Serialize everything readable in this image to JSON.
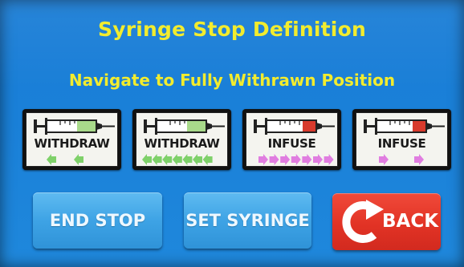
{
  "screen": {
    "title": "Syringe Stop Definition",
    "instruction": "Navigate to Fully Withrawn Position"
  },
  "tiles": [
    {
      "label": "WITHDRAW",
      "direction": "withdraw",
      "speed": "slow",
      "arrow_count": 2,
      "arrow_color": "#7fd16a",
      "plunger_color": "#a8d98a"
    },
    {
      "label": "WITHDRAW",
      "direction": "withdraw",
      "speed": "fast",
      "arrow_count": 7,
      "arrow_color": "#7fd16a",
      "plunger_color": "#a8d98a"
    },
    {
      "label": "INFUSE",
      "direction": "infuse",
      "speed": "fast",
      "arrow_count": 7,
      "arrow_color": "#e07de0",
      "plunger_color": "#d83a2c"
    },
    {
      "label": "INFUSE",
      "direction": "infuse",
      "speed": "slow",
      "arrow_count": 2,
      "arrow_color": "#e07de0",
      "plunger_color": "#d83a2c"
    }
  ],
  "buttons": {
    "end_stop": "END STOP",
    "set_syringe": "SET SYRINGE",
    "back": "BACK"
  },
  "colors": {
    "background": "#1a80d8",
    "title_text": "#f2ec2e",
    "button_blue": "#3ea3e5",
    "back_red": "#e23325"
  },
  "icons": {
    "back": "curved-back-arrow-icon",
    "tiles": "syringe-icon"
  }
}
